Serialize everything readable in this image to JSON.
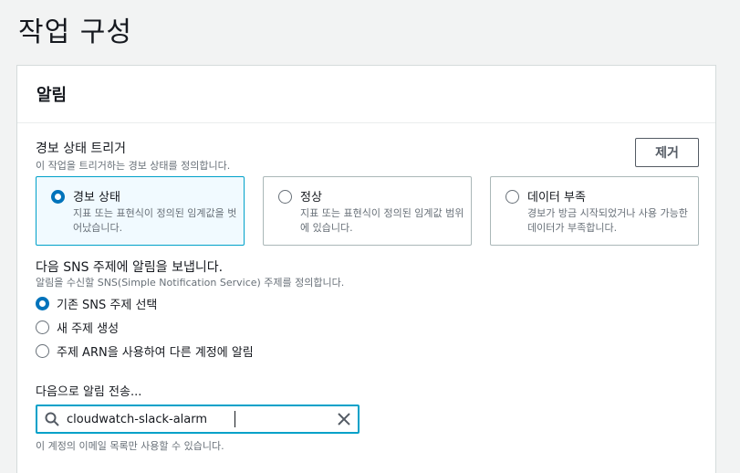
{
  "page": {
    "title": "작업 구성"
  },
  "panel": {
    "title": "알림",
    "trigger": {
      "label": "경보 상태 트리거",
      "description": "이 작업을 트리거하는 경보 상태를 정의합니다.",
      "remove_label": "제거",
      "tiles": [
        {
          "title": "경보 상태",
          "description": "지표 또는 표현식이 정의된 임계값을 벗어났습니다.",
          "selected": true
        },
        {
          "title": "정상",
          "description": "지표 또는 표현식이 정의된 임계값 범위에 있습니다.",
          "selected": false
        },
        {
          "title": "데이터 부족",
          "description": "경보가 방금 시작되었거나 사용 가능한 데이터가 부족합니다.",
          "selected": false
        }
      ]
    },
    "sns": {
      "label": "다음 SNS 주제에 알림을 보냅니다.",
      "description": "알림을 수신할 SNS(Simple Notification Service) 주제를 정의합니다.",
      "options": [
        {
          "label": "기존 SNS 주제 선택",
          "checked": true
        },
        {
          "label": "새 주제 생성",
          "checked": false
        },
        {
          "label": "주제 ARN을 사용하여 다른 계정에 알림",
          "checked": false
        }
      ]
    },
    "send_to": {
      "label": "다음으로 알림 전송...",
      "value": "cloudwatch-slack-alarm",
      "hint": "이 계정의 이메일 목록만 사용할 수 있습니다."
    }
  },
  "colors": {
    "accent": "#0073bb",
    "focus": "#00a1c9",
    "selected_bg": "#f1faff"
  }
}
